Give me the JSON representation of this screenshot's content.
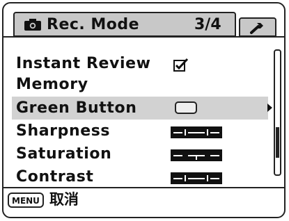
{
  "header": {
    "title": "Rec. Mode",
    "page": "3/4",
    "camera_icon": "camera-icon",
    "setup_icon": "wrench-icon"
  },
  "menu": {
    "items": [
      {
        "label_line1": "Instant Review",
        "label_line2": "Memory",
        "value": "checked",
        "icon": "checkbox-icon"
      },
      {
        "label": "Green Button",
        "value": "rounded-rectangle",
        "icon": "green-button-icon",
        "selected": true,
        "submenu_arrow": "arrow-right-icon"
      },
      {
        "label": "Sharpness",
        "level": 0,
        "icon": "level-indicator-icon"
      },
      {
        "label": "Saturation",
        "level": 0,
        "icon": "level-indicator-icon"
      },
      {
        "label": "Contrast",
        "level": 0,
        "icon": "level-indicator-icon"
      }
    ]
  },
  "scrollbar": {
    "page": 3,
    "pages": 4
  },
  "footer": {
    "key": "MENU",
    "action": "取消"
  },
  "colors": {
    "tab_background": "#c8c8c8",
    "selection": "#d2d2d2",
    "foreground": "#111111",
    "background": "#ffffff"
  }
}
